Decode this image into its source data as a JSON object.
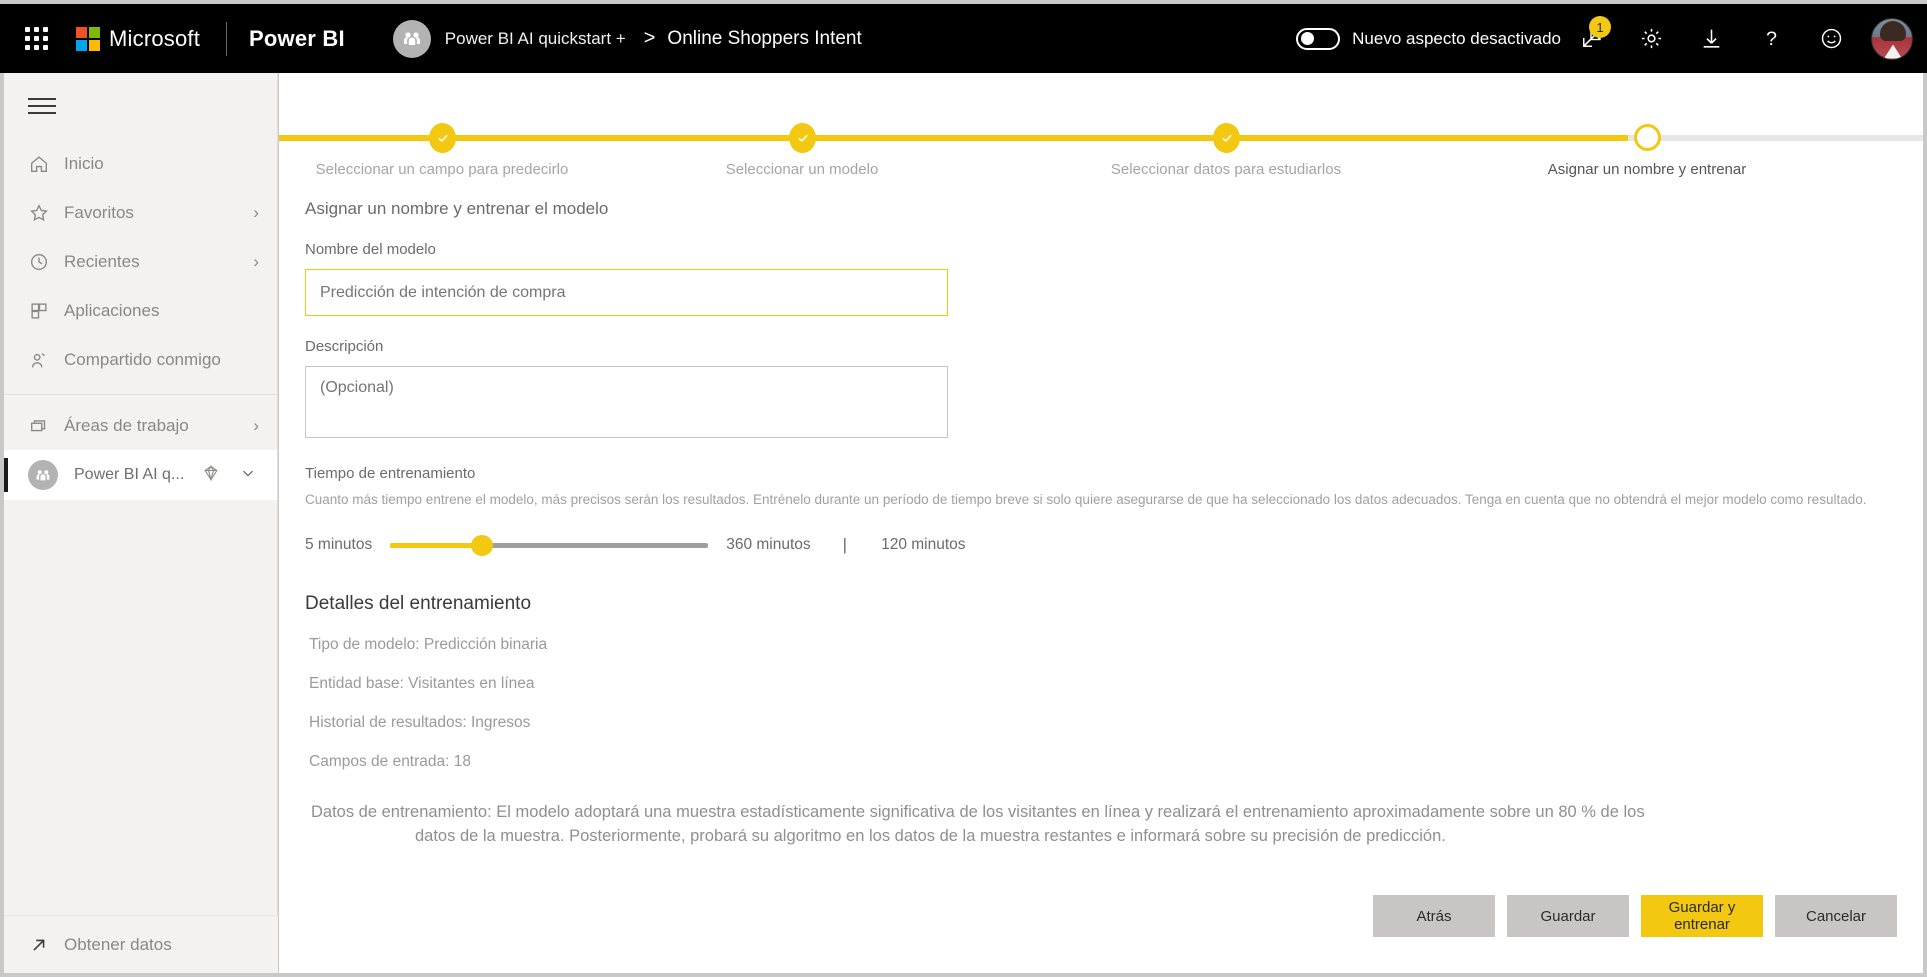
{
  "topbar": {
    "waffle_icon": "app-launcher-icon",
    "microsoft_label": "Microsoft",
    "product_label": "Power BI",
    "workspace_label": "Power BI AI quickstart +",
    "breadcrumb_separator": ">",
    "breadcrumb_current": "Online Shoppers Intent",
    "toggle_label": "Nuevo aspecto desactivado",
    "toggle_state": "off",
    "notification_badge": "1",
    "icons": [
      "expand-icon",
      "gear-icon",
      "download-icon",
      "help-icon",
      "feedback-smiley-icon",
      "avatar"
    ]
  },
  "sidebar": {
    "hamburger_icon": "hamburger-menu-icon",
    "items": [
      {
        "label": "Inicio",
        "icon": "home-icon",
        "chevron": false
      },
      {
        "label": "Favoritos",
        "icon": "star-icon",
        "chevron": true
      },
      {
        "label": "Recientes",
        "icon": "clock-icon",
        "chevron": true
      },
      {
        "label": "Aplicaciones",
        "icon": "apps-grid-icon",
        "chevron": false
      },
      {
        "label": "Compartido conmigo",
        "icon": "shared-person-icon",
        "chevron": false
      }
    ],
    "workspaces": {
      "label": "Áreas de trabajo",
      "icon": "workspaces-stack-icon",
      "chevron": true
    },
    "active_workspace": {
      "label": "Power BI AI q...",
      "avatar_icon": "workspace-group-icon",
      "premium_icon": "diamond-icon",
      "chevron_icon": "chevron-down-icon"
    },
    "get_data": {
      "label": "Obtener datos",
      "icon": "arrow-up-right-icon"
    }
  },
  "stepper": {
    "steps": [
      {
        "label": "Seleccionar un campo para predecirlo",
        "state": "done"
      },
      {
        "label": "Seleccionar un modelo",
        "state": "done"
      },
      {
        "label": "Seleccionar datos para estudiarlos",
        "state": "done"
      },
      {
        "label": "Asignar un nombre y entrenar",
        "state": "current"
      }
    ],
    "progress_percent": 83,
    "accent_color": "#f2c811"
  },
  "form": {
    "section_title": "Asignar un nombre y entrenar el modelo",
    "name_label": "Nombre del modelo",
    "name_value": "Predicción de intención de compra",
    "name_placeholder": "Predicción de intención de compra",
    "description_label": "Descripción",
    "description_value": "",
    "description_placeholder": "(Opcional)"
  },
  "training_time": {
    "title": "Tiempo de entrenamiento",
    "help": "Cuanto más tiempo entrene el modelo, más precisos serán los resultados. Entrénelo durante un período de tiempo breve si solo quiere asegurarse de que ha seleccionado los datos adecuados. Tenga en cuenta que no obtendrá el mejor modelo como resultado.",
    "min_label": "5 minutos",
    "max_label": "360 minutos",
    "separator": "|",
    "current_label": "120 minutos",
    "min_value": 5,
    "max_value": 360,
    "current_value": 120,
    "fill_percent": 29
  },
  "details": {
    "title": "Detalles del entrenamiento",
    "lines": [
      "Tipo de modelo: Predicción binaria",
      "Entidad base: Visitantes en línea",
      "Historial de resultados: Ingresos",
      "Campos de entrada: 18"
    ]
  },
  "training_data_note": {
    "line1": "Datos de entrenamiento: El modelo adoptará una muestra estadísticamente significativa de los visitantes en línea y realizará el entrenamiento aproximadamente sobre un 80 % de los",
    "line2": "datos de la muestra. Posteriormente, probará su algoritmo en los datos de la muestra restantes e informará sobre su precisión de predicción."
  },
  "buttons": {
    "back": "Atrás",
    "save": "Guardar",
    "save_and_train": "Guardar y entrenar",
    "cancel": "Cancelar"
  }
}
